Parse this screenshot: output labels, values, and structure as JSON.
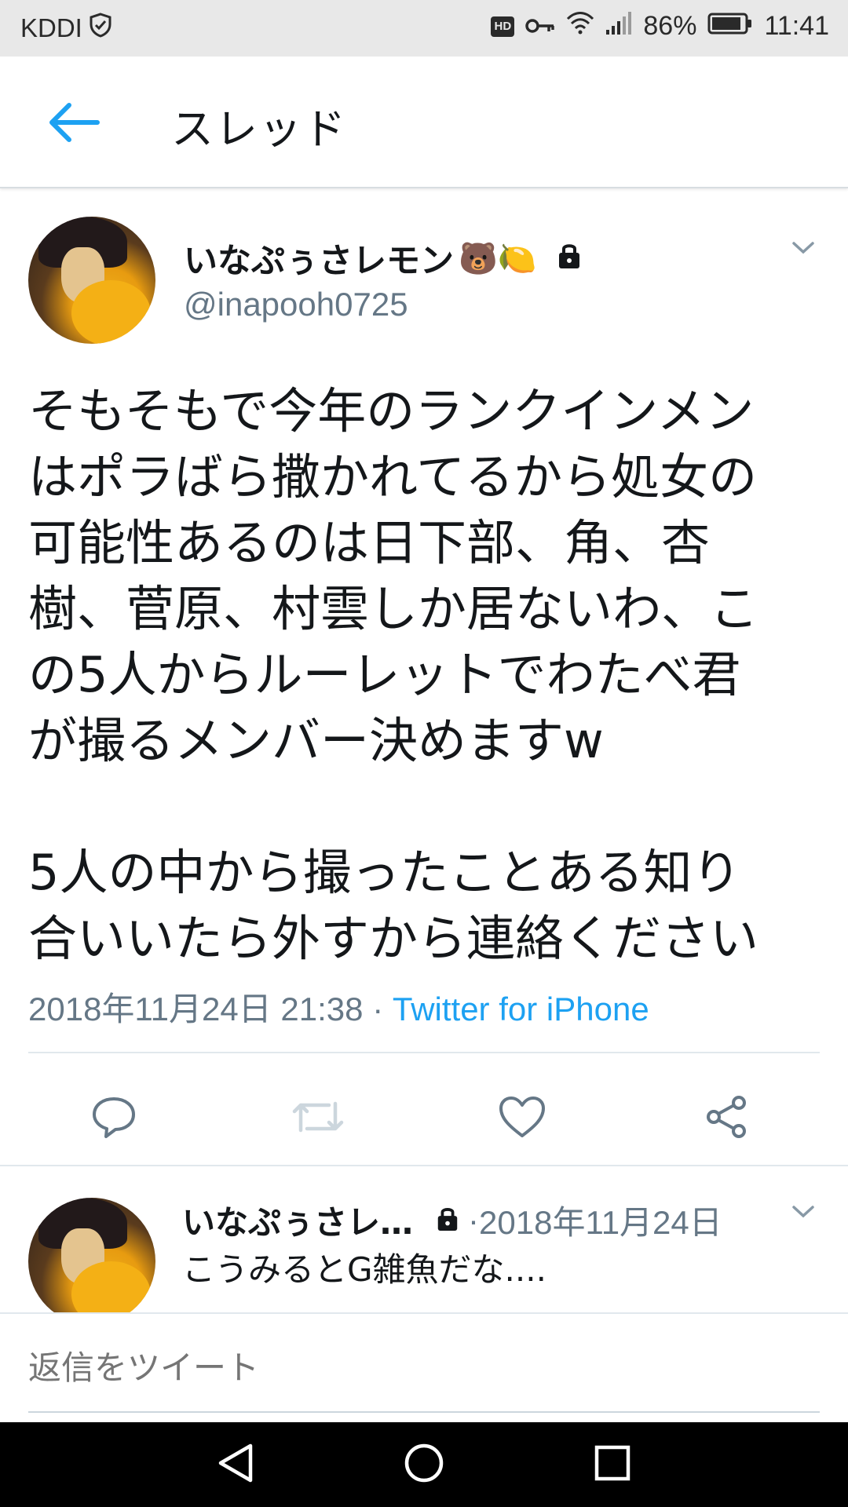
{
  "status_bar": {
    "carrier": "KDDI",
    "hd_badge": "HD",
    "battery": "86%",
    "time": "11:41"
  },
  "header": {
    "title": "スレッド"
  },
  "tweet": {
    "author_name": "いなぷぅさレモン",
    "author_emojis": "🐻🍋",
    "handle": "@inapooh0725",
    "text": "そもそもで今年のランクインメン\nはポラばら撒かれてるから処女の\n可能性あるのは日下部、角、杏\n樹、菅原、村雲しか居ないわ、こ\nの5人からルーレットでわたべ君\nが撮るメンバー決めますw\n\n5人の中から撮ったことある知り\n合いいたら外すから連絡ください",
    "timestamp": "2018年11月24日 21:38",
    "separator": " · ",
    "source": "Twitter for iPhone"
  },
  "reply": {
    "author_name": "いなぷぅさレ…",
    "separator": " · ",
    "date": "2018年11月24日",
    "text": "こうみるとG雑魚だな...."
  },
  "reply_box": {
    "placeholder": "返信をツイート"
  },
  "icons": {
    "back": "arrow-left-icon",
    "caret": "chevron-down-icon",
    "lock": "lock-icon",
    "reply": "reply-icon",
    "retweet": "retweet-icon",
    "like": "heart-icon",
    "share": "share-icon",
    "nav_back": "nav-back-icon",
    "nav_home": "nav-home-icon",
    "nav_recents": "nav-recents-icon"
  },
  "colors": {
    "accent": "#1da1f2",
    "secondary_text": "#657786",
    "retweet_disabled": "#ccd6dd"
  }
}
